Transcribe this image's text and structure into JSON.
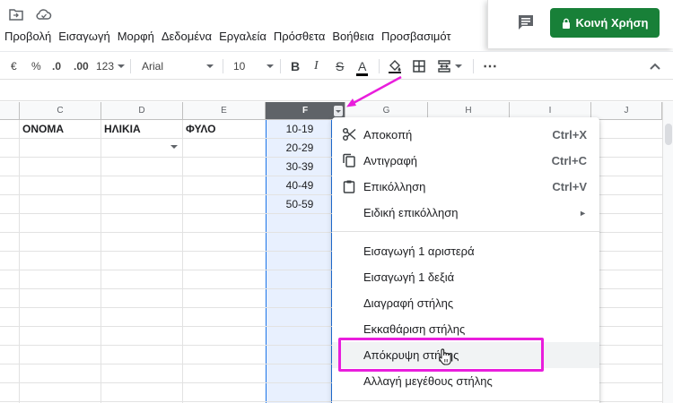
{
  "menubar": {
    "items": [
      "Προβολή",
      "Εισαγωγή",
      "Μορφή",
      "Δεδομένα",
      "Εργαλεία",
      "Πρόσθετα",
      "Βοήθεια",
      "Προσβασιμότ"
    ]
  },
  "share": {
    "label": "Κοινή Χρήση",
    "color": "#188038"
  },
  "toolbar": {
    "currency": "€",
    "percent": "%",
    "decrease_decimals": ".0",
    "increase_decimals": ".00",
    "more_formats": "123",
    "font": "Arial",
    "font_size": "10",
    "bold": "B",
    "italic": "I",
    "strike": "S",
    "text_color": "A"
  },
  "grid": {
    "columns": [
      "C",
      "D",
      "E",
      "F",
      "G",
      "H",
      "I",
      "J"
    ],
    "selected_column": "F",
    "headers": {
      "c": "ΟΝΟΜΑ",
      "d": "ΗΛΙΚΙΑ",
      "e": "ΦΥΛΟ"
    },
    "f_values": [
      "10-19",
      "20-29",
      "30-39",
      "40-49",
      "50-59"
    ]
  },
  "context_menu": {
    "items": [
      {
        "label": "Αποκοπή",
        "shortcut": "Ctrl+X",
        "icon": "scissors-icon"
      },
      {
        "label": "Αντιγραφή",
        "shortcut": "Ctrl+C",
        "icon": "copy-icon"
      },
      {
        "label": "Επικόλληση",
        "shortcut": "Ctrl+V",
        "icon": "clipboard-icon"
      },
      {
        "label": "Ειδική επικόλληση",
        "submenu": "►"
      },
      {
        "label": "Εισαγωγή 1 αριστερά"
      },
      {
        "label": "Εισαγωγή 1 δεξιά"
      },
      {
        "label": "Διαγραφή στήλης"
      },
      {
        "label": "Εκκαθάριση στήλης"
      },
      {
        "label": "Απόκρυψη στήλης"
      },
      {
        "label": "Αλλαγή μεγέθους στήλης"
      }
    ],
    "hovered_item": "Απόκρυψη στήλης"
  },
  "annotation_color": "#e91edc"
}
